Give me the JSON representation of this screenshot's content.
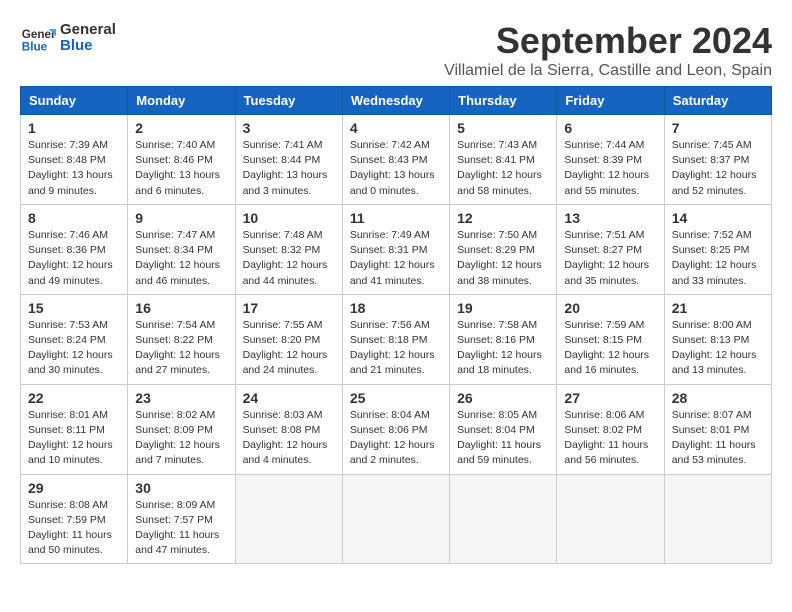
{
  "header": {
    "logo_general": "General",
    "logo_blue": "Blue",
    "month_title": "September 2024",
    "location": "Villamiel de la Sierra, Castille and Leon, Spain"
  },
  "columns": [
    "Sunday",
    "Monday",
    "Tuesday",
    "Wednesday",
    "Thursday",
    "Friday",
    "Saturday"
  ],
  "weeks": [
    [
      {
        "day": "1",
        "sunrise": "7:39 AM",
        "sunset": "8:48 PM",
        "daylight": "13 hours and 9 minutes."
      },
      {
        "day": "2",
        "sunrise": "7:40 AM",
        "sunset": "8:46 PM",
        "daylight": "13 hours and 6 minutes."
      },
      {
        "day": "3",
        "sunrise": "7:41 AM",
        "sunset": "8:44 PM",
        "daylight": "13 hours and 3 minutes."
      },
      {
        "day": "4",
        "sunrise": "7:42 AM",
        "sunset": "8:43 PM",
        "daylight": "13 hours and 0 minutes."
      },
      {
        "day": "5",
        "sunrise": "7:43 AM",
        "sunset": "8:41 PM",
        "daylight": "12 hours and 58 minutes."
      },
      {
        "day": "6",
        "sunrise": "7:44 AM",
        "sunset": "8:39 PM",
        "daylight": "12 hours and 55 minutes."
      },
      {
        "day": "7",
        "sunrise": "7:45 AM",
        "sunset": "8:37 PM",
        "daylight": "12 hours and 52 minutes."
      }
    ],
    [
      {
        "day": "8",
        "sunrise": "7:46 AM",
        "sunset": "8:36 PM",
        "daylight": "12 hours and 49 minutes."
      },
      {
        "day": "9",
        "sunrise": "7:47 AM",
        "sunset": "8:34 PM",
        "daylight": "12 hours and 46 minutes."
      },
      {
        "day": "10",
        "sunrise": "7:48 AM",
        "sunset": "8:32 PM",
        "daylight": "12 hours and 44 minutes."
      },
      {
        "day": "11",
        "sunrise": "7:49 AM",
        "sunset": "8:31 PM",
        "daylight": "12 hours and 41 minutes."
      },
      {
        "day": "12",
        "sunrise": "7:50 AM",
        "sunset": "8:29 PM",
        "daylight": "12 hours and 38 minutes."
      },
      {
        "day": "13",
        "sunrise": "7:51 AM",
        "sunset": "8:27 PM",
        "daylight": "12 hours and 35 minutes."
      },
      {
        "day": "14",
        "sunrise": "7:52 AM",
        "sunset": "8:25 PM",
        "daylight": "12 hours and 33 minutes."
      }
    ],
    [
      {
        "day": "15",
        "sunrise": "7:53 AM",
        "sunset": "8:24 PM",
        "daylight": "12 hours and 30 minutes."
      },
      {
        "day": "16",
        "sunrise": "7:54 AM",
        "sunset": "8:22 PM",
        "daylight": "12 hours and 27 minutes."
      },
      {
        "day": "17",
        "sunrise": "7:55 AM",
        "sunset": "8:20 PM",
        "daylight": "12 hours and 24 minutes."
      },
      {
        "day": "18",
        "sunrise": "7:56 AM",
        "sunset": "8:18 PM",
        "daylight": "12 hours and 21 minutes."
      },
      {
        "day": "19",
        "sunrise": "7:58 AM",
        "sunset": "8:16 PM",
        "daylight": "12 hours and 18 minutes."
      },
      {
        "day": "20",
        "sunrise": "7:59 AM",
        "sunset": "8:15 PM",
        "daylight": "12 hours and 16 minutes."
      },
      {
        "day": "21",
        "sunrise": "8:00 AM",
        "sunset": "8:13 PM",
        "daylight": "12 hours and 13 minutes."
      }
    ],
    [
      {
        "day": "22",
        "sunrise": "8:01 AM",
        "sunset": "8:11 PM",
        "daylight": "12 hours and 10 minutes."
      },
      {
        "day": "23",
        "sunrise": "8:02 AM",
        "sunset": "8:09 PM",
        "daylight": "12 hours and 7 minutes."
      },
      {
        "day": "24",
        "sunrise": "8:03 AM",
        "sunset": "8:08 PM",
        "daylight": "12 hours and 4 minutes."
      },
      {
        "day": "25",
        "sunrise": "8:04 AM",
        "sunset": "8:06 PM",
        "daylight": "12 hours and 2 minutes."
      },
      {
        "day": "26",
        "sunrise": "8:05 AM",
        "sunset": "8:04 PM",
        "daylight": "11 hours and 59 minutes."
      },
      {
        "day": "27",
        "sunrise": "8:06 AM",
        "sunset": "8:02 PM",
        "daylight": "11 hours and 56 minutes."
      },
      {
        "day": "28",
        "sunrise": "8:07 AM",
        "sunset": "8:01 PM",
        "daylight": "11 hours and 53 minutes."
      }
    ],
    [
      {
        "day": "29",
        "sunrise": "8:08 AM",
        "sunset": "7:59 PM",
        "daylight": "11 hours and 50 minutes."
      },
      {
        "day": "30",
        "sunrise": "8:09 AM",
        "sunset": "7:57 PM",
        "daylight": "11 hours and 47 minutes."
      },
      null,
      null,
      null,
      null,
      null
    ]
  ]
}
